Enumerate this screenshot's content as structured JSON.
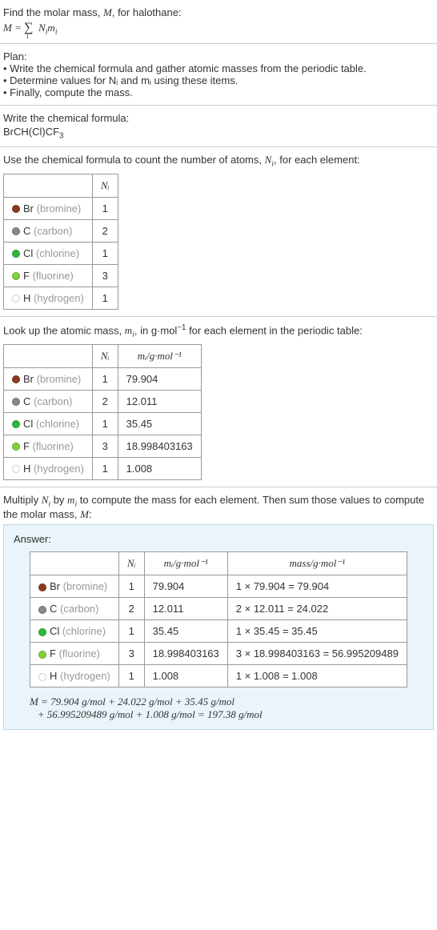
{
  "intro": {
    "line1_a": "Find the molar mass, ",
    "line1_b": ", for halothane:",
    "eq_lhs": "M",
    "eq_eq": " = ",
    "eq_sum": "∑",
    "eq_sub": "i",
    "eq_rhs_a": "N",
    "eq_rhs_b": "m"
  },
  "plan": {
    "title": "Plan:",
    "items": [
      "Write the chemical formula and gather atomic masses from the periodic table.",
      "Determine values for Nᵢ and mᵢ using these items.",
      "Finally, compute the mass."
    ]
  },
  "chem": {
    "title": "Write the chemical formula:",
    "formula_a": "BrCH(Cl)CF",
    "formula_sub": "3"
  },
  "count": {
    "intro_a": "Use the chemical formula to count the number of atoms, ",
    "intro_b": ", for each element:",
    "header": "Nᵢ",
    "rows": [
      {
        "color": "#8a3a1e",
        "sym": "Br",
        "name": "(bromine)",
        "n": "1"
      },
      {
        "color": "#888",
        "sym": "C",
        "name": "(carbon)",
        "n": "2"
      },
      {
        "color": "#2db83d",
        "sym": "Cl",
        "name": "(chlorine)",
        "n": "1"
      },
      {
        "color": "#7fd13b",
        "sym": "F",
        "name": "(fluorine)",
        "n": "3"
      },
      {
        "color": "#fff",
        "sym": "H",
        "name": "(hydrogen)",
        "n": "1"
      }
    ]
  },
  "masses": {
    "intro_a": "Look up the atomic mass, ",
    "intro_b": ", in g·mol",
    "intro_c": " for each element in the periodic table:",
    "h1": "Nᵢ",
    "h2": "mᵢ/g·mol⁻¹",
    "rows": [
      {
        "color": "#8a3a1e",
        "sym": "Br",
        "name": "(bromine)",
        "n": "1",
        "m": "79.904"
      },
      {
        "color": "#888",
        "sym": "C",
        "name": "(carbon)",
        "n": "2",
        "m": "12.011"
      },
      {
        "color": "#2db83d",
        "sym": "Cl",
        "name": "(chlorine)",
        "n": "1",
        "m": "35.45"
      },
      {
        "color": "#7fd13b",
        "sym": "F",
        "name": "(fluorine)",
        "n": "3",
        "m": "18.998403163"
      },
      {
        "color": "#fff",
        "sym": "H",
        "name": "(hydrogen)",
        "n": "1",
        "m": "1.008"
      }
    ]
  },
  "compute": {
    "intro_a": "Multiply ",
    "intro_b": " by ",
    "intro_c": " to compute the mass for each element. Then sum those values to compute the molar mass, ",
    "intro_d": ":"
  },
  "answer": {
    "label": "Answer:",
    "h1": "Nᵢ",
    "h2": "mᵢ/g·mol⁻¹",
    "h3": "mass/g·mol⁻¹",
    "rows": [
      {
        "color": "#8a3a1e",
        "sym": "Br",
        "name": "(bromine)",
        "n": "1",
        "m": "79.904",
        "calc": "1 × 79.904 = 79.904"
      },
      {
        "color": "#888",
        "sym": "C",
        "name": "(carbon)",
        "n": "2",
        "m": "12.011",
        "calc": "2 × 12.011 = 24.022"
      },
      {
        "color": "#2db83d",
        "sym": "Cl",
        "name": "(chlorine)",
        "n": "1",
        "m": "35.45",
        "calc": "1 × 35.45 = 35.45"
      },
      {
        "color": "#7fd13b",
        "sym": "F",
        "name": "(fluorine)",
        "n": "3",
        "m": "18.998403163",
        "calc": "3 × 18.998403163 = 56.995209489"
      },
      {
        "color": "#fff",
        "sym": "H",
        "name": "(hydrogen)",
        "n": "1",
        "m": "1.008",
        "calc": "1 × 1.008 = 1.008"
      }
    ],
    "final_l1": "M = 79.904 g/mol + 24.022 g/mol + 35.45 g/mol",
    "final_l2": "   + 56.995209489 g/mol + 1.008 g/mol = 197.38 g/mol"
  }
}
